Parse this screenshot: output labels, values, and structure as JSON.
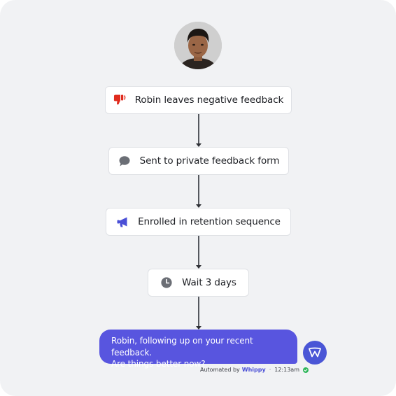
{
  "contact": {
    "name": "Robin",
    "avatar_icon": "person-photo-avatar"
  },
  "flow": {
    "steps": [
      {
        "label": "Robin leaves negative feedback",
        "icon": "thumbs-down-icon",
        "icon_color": "#e02b1d"
      },
      {
        "label": "Sent to private feedback form",
        "icon": "chat-bubble-icon",
        "icon_color": "#6b6e75"
      },
      {
        "label": "Enrolled in retention sequence",
        "icon": "megaphone-icon",
        "icon_color": "#4a4fd6"
      },
      {
        "label": "Wait 3 days",
        "icon": "clock-icon",
        "icon_color": "#6b6e75"
      }
    ]
  },
  "message": {
    "line1": "Robin, following up on your recent feedback.",
    "line2": "Are things better now?",
    "bubble_color": "#5855df",
    "automated_prefix": "Automated by",
    "brand": "Whippy",
    "separator": "·",
    "time": "12:13am",
    "status": "delivered",
    "status_color": "#2fb65a"
  }
}
